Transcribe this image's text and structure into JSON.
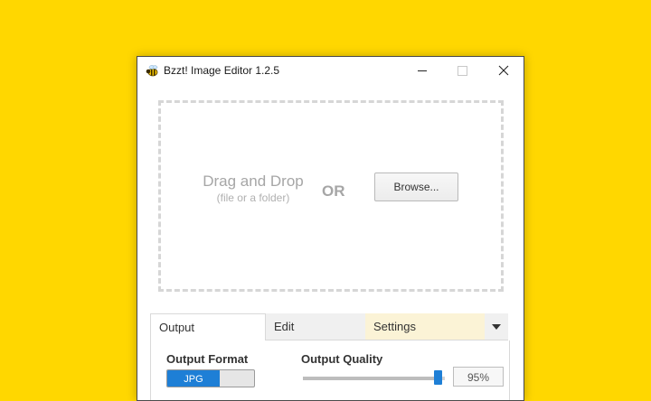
{
  "window": {
    "title": "Bzzt! Image Editor 1.2.5",
    "app_icon": "bee-icon"
  },
  "dropzone": {
    "title": "Drag and Drop",
    "subtitle": "(file or a folder)",
    "or_label": "OR",
    "browse_label": "Browse..."
  },
  "tabs": [
    {
      "label": "Output",
      "active": true
    },
    {
      "label": "Edit",
      "active": false
    },
    {
      "label": "Settings",
      "active": false
    }
  ],
  "output": {
    "format_label": "Output Format",
    "format_selected": "JPG",
    "quality_label": "Output Quality",
    "quality_value": "95%",
    "quality_level": 0.95
  },
  "colors": {
    "background": "#FFD700",
    "accent": "#1e7fd6",
    "settings_tab": "#fbf3d6"
  }
}
